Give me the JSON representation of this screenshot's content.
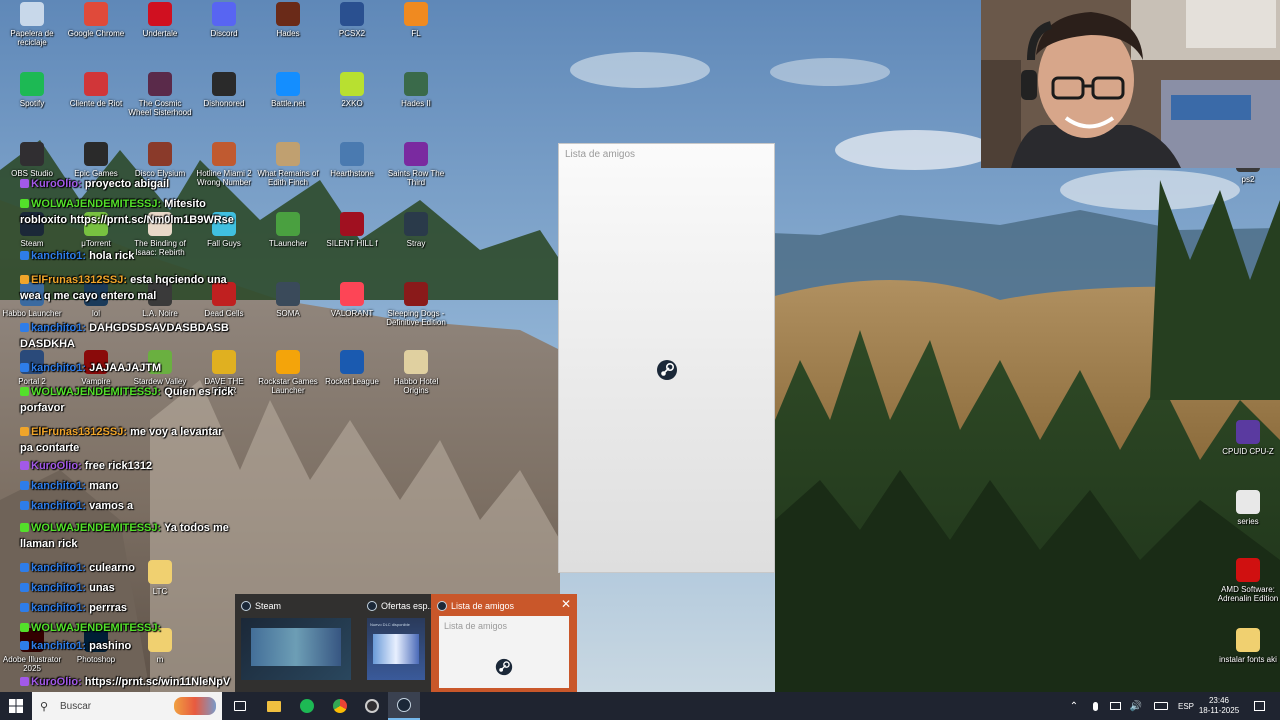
{
  "desktop_icons": [
    {
      "label": "Papelera de reciclaje",
      "icon": "recycle-bin-icon",
      "color": "#c8d8ea"
    },
    {
      "label": "Google Chrome",
      "icon": "chrome-icon",
      "color": "#e04a3a"
    },
    {
      "label": "Undertale",
      "icon": "undertale-heart-icon",
      "color": "#d01020"
    },
    {
      "label": "Discord",
      "icon": "discord-icon",
      "color": "#5865f2"
    },
    {
      "label": "Hades",
      "icon": "hades-icon",
      "color": "#6a2a18"
    },
    {
      "label": "PCSX2",
      "icon": "pcsx2-icon",
      "color": "#2a5090"
    },
    {
      "label": "FL",
      "icon": "fl-studio-icon",
      "color": "#f08a20"
    },
    {
      "label": "Spotify",
      "icon": "spotify-icon",
      "color": "#1db954"
    },
    {
      "label": "Cliente de Riot",
      "icon": "riot-icon",
      "color": "#d13639"
    },
    {
      "label": "The Cosmic Wheel Sisterhood",
      "icon": "cosmic-wheel-icon",
      "color": "#5a2a4a"
    },
    {
      "label": "Dishonored",
      "icon": "dishonored-icon",
      "color": "#2a2a2a"
    },
    {
      "label": "Battle.net",
      "icon": "battlenet-icon",
      "color": "#148eff"
    },
    {
      "label": "2XKO",
      "icon": "2xko-icon",
      "color": "#b8e030"
    },
    {
      "label": "Hades II",
      "icon": "hades2-icon",
      "color": "#3a6a4a"
    },
    {
      "label": "OBS Studio",
      "icon": "obs-icon",
      "color": "#302e31"
    },
    {
      "label": "Epic Games",
      "icon": "epic-games-icon",
      "color": "#2a2a2a"
    },
    {
      "label": "Disco Elysium",
      "icon": "disco-elysium-icon",
      "color": "#8a3a2a"
    },
    {
      "label": "Hotline Miami 2 Wrong Number",
      "icon": "hotline-miami-icon",
      "color": "#c05a30"
    },
    {
      "label": "What Remains of Edith Finch",
      "icon": "edith-finch-icon",
      "color": "#c0a070"
    },
    {
      "label": "Hearthstone",
      "icon": "hearthstone-icon",
      "color": "#4a7ab0"
    },
    {
      "label": "Saints Row The Third",
      "icon": "saints-row-icon",
      "color": "#7a2aa0"
    },
    {
      "label": "Steam",
      "icon": "steam-icon",
      "color": "#1b2838"
    },
    {
      "label": "μTorrent",
      "icon": "utorrent-icon",
      "color": "#78c140"
    },
    {
      "label": "The Binding of Isaac: Rebirth",
      "icon": "isaac-icon",
      "color": "#e8d8c8"
    },
    {
      "label": "Fall Guys",
      "icon": "fall-guys-icon",
      "color": "#40c0e0"
    },
    {
      "label": "TLauncher",
      "icon": "tlauncher-icon",
      "color": "#4aa040"
    },
    {
      "label": "SILENT HILL f",
      "icon": "silent-hill-icon",
      "color": "#a01020"
    },
    {
      "label": "Stray",
      "icon": "stray-icon",
      "color": "#2a3a4a"
    },
    {
      "label": "Habbo Launcher",
      "icon": "habbo-launcher-icon",
      "color": "#3a6aa0"
    },
    {
      "label": "lol",
      "icon": "lol-icon",
      "color": "#1a3a5a"
    },
    {
      "label": "L.A. Noire",
      "icon": "la-noire-icon",
      "color": "#3a3a3a"
    },
    {
      "label": "Dead Cells",
      "icon": "dead-cells-icon",
      "color": "#c02020"
    },
    {
      "label": "SOMA",
      "icon": "soma-icon",
      "color": "#3a4a5a"
    },
    {
      "label": "VALORANT",
      "icon": "valorant-icon",
      "color": "#fd4556"
    },
    {
      "label": "Sleeping Dogs - Definitive Edition",
      "icon": "sleeping-dogs-icon",
      "color": "#8a1a1a"
    },
    {
      "label": "Portal 2",
      "icon": "portal2-icon",
      "color": "#2a4a7a"
    },
    {
      "label": "Vampire",
      "icon": "vampire-icon",
      "color": "#8a0a0a"
    },
    {
      "label": "Stardew Valley",
      "icon": "stardew-icon",
      "color": "#6ab040"
    },
    {
      "label": "DAVE THE DIVER",
      "icon": "dave-diver-icon",
      "color": "#e0b020"
    },
    {
      "label": "Rockstar Games Launcher",
      "icon": "rockstar-icon",
      "color": "#f4a40a"
    },
    {
      "label": "Rocket League",
      "icon": "rocket-league-icon",
      "color": "#1a5ab0"
    },
    {
      "label": "Habbo Hotel Origins",
      "icon": "habbo-origins-icon",
      "color": "#e0d0a0"
    },
    {
      "label": "LTC",
      "icon": "ltc-folder-icon",
      "color": "#f0d070"
    },
    {
      "label": "Adobe Illustrator 2025",
      "icon": "illustrator-icon",
      "color": "#330000"
    },
    {
      "label": "Photoshop",
      "icon": "photoshop-icon",
      "color": "#001e36"
    },
    {
      "label": "m",
      "icon": "m-folder-icon",
      "color": "#f0d070"
    },
    {
      "label": "CPUID CPU-Z",
      "icon": "cpuz-icon",
      "color": "#5a3aa0"
    },
    {
      "label": "series",
      "icon": "series-file-icon",
      "color": "#e8e8e8"
    },
    {
      "label": "AMD Software: Adrenalin Edition",
      "icon": "amd-icon",
      "color": "#d01010"
    },
    {
      "label": "instalar fonts aki",
      "icon": "fonts-folder-icon",
      "color": "#f0d070"
    },
    {
      "label": "ps2",
      "icon": "ps2-icon",
      "color": "#3a3a3a"
    }
  ],
  "chat": [
    {
      "user": "KuroOlio",
      "text": "proyecto abigail",
      "color": "#a259e8"
    },
    {
      "user": "WOLWAJENDEMITESSJ",
      "text": "Mitesito robloxito https://prnt.sc/Nm0lm1B9WRse",
      "color": "#53e02a"
    },
    {
      "user": "kanchito1",
      "text": "hola rick",
      "color": "#2e7de9"
    },
    {
      "user": "ElFrunas1312SSJ",
      "text": "esta hqciendo una wea q me cayo entero mal",
      "color": "#f0a52a"
    },
    {
      "user": "kanchito1",
      "text": "DAHGDSDSAVDASBDASB DASDKHA",
      "color": "#2e7de9"
    },
    {
      "user": "kanchito1",
      "text": "JAJAAJAJTM",
      "color": "#2e7de9"
    },
    {
      "user": "WOLWAJENDEMITESSJ",
      "text": "Quien es rick porfavor",
      "color": "#53e02a"
    },
    {
      "user": "ElFrunas1312SSJ",
      "text": "me voy a levantar pa contarte",
      "color": "#f0a52a"
    },
    {
      "user": "KuroOlio",
      "text": "free rick1312",
      "color": "#a259e8"
    },
    {
      "user": "kanchito1",
      "text": "mano",
      "color": "#2e7de9"
    },
    {
      "user": "kanchito1",
      "text": "vamos a",
      "color": "#2e7de9"
    },
    {
      "user": "WOLWAJENDEMITESSJ",
      "text": "Ya todos me llaman rick",
      "color": "#53e02a"
    },
    {
      "user": "kanchito1",
      "text": "culearno",
      "color": "#2e7de9"
    },
    {
      "user": "kanchito1",
      "text": "unas",
      "color": "#2e7de9"
    },
    {
      "user": "kanchito1",
      "text": "perrras",
      "color": "#2e7de9"
    },
    {
      "user": "WOLWAJENDEMITESSJ",
      "text": "",
      "color": "#53e02a"
    },
    {
      "user": "kanchito1",
      "text": "pashino",
      "color": "#2e7de9"
    },
    {
      "user": "KuroOlio",
      "text": "https://prnt.sc/win11NleNpV",
      "color": "#a259e8"
    }
  ],
  "friends_window": {
    "title": "Lista de amigos"
  },
  "taskbar_preview": {
    "items": [
      {
        "label": "Steam"
      },
      {
        "label": "Ofertas esp..."
      },
      {
        "label": "Lista de amigos"
      }
    ],
    "thumb_friends_title": "Lista de amigos",
    "thumb_offers_caption": "Nuevo DLC disponible"
  },
  "taskbar": {
    "search_placeholder": "Buscar",
    "pinned": [
      "task-view-icon",
      "file-explorer-icon",
      "spotify-icon",
      "chrome-icon",
      "obs-icon",
      "steam-icon"
    ],
    "tray_lang": "ESP",
    "time": "23:46",
    "date": "18-11-2025"
  }
}
